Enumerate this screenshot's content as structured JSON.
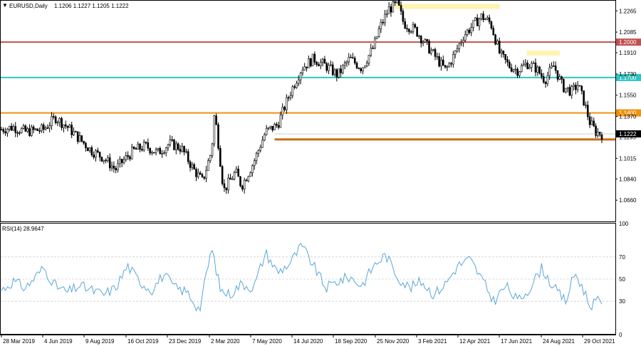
{
  "header": {
    "symbol": "EURUSD,Daily",
    "ohlc": "1.1206 1.1227 1.1205 1.1222",
    "rsi_label": "RSI(14) 28.9647"
  },
  "chart_data": [
    {
      "type": "candlestick",
      "title": "EURUSD,Daily",
      "ylim": [
        1.048,
        1.2345
      ],
      "y_ticks": [
        "1.2265",
        "1.2085",
        "1.1910",
        "1.1730",
        "1.1550",
        "1.1370",
        "1.1195",
        "1.1015",
        "1.0840",
        "1.0660"
      ],
      "x_ticks": [
        "28 Mar 2019",
        "4 Jun 2019",
        "9 Aug 2019",
        "16 Oct 2019",
        "23 Dec 2019",
        "2 Mar 2020",
        "7 May 2020",
        "14 Jul 2020",
        "18 Sep 2020",
        "25 Nov 2020",
        "3 Feb 2021",
        "12 Apr 2021",
        "17 Jun 2021",
        "24 Aug 2021",
        "29 Oct 2021"
      ],
      "price_path": [
        [
          0,
          1.126
        ],
        [
          0.02,
          1.128
        ],
        [
          0.04,
          1.124
        ],
        [
          0.07,
          1.126
        ],
        [
          0.09,
          1.136
        ],
        [
          0.11,
          1.128
        ],
        [
          0.13,
          1.118
        ],
        [
          0.15,
          1.108
        ],
        [
          0.17,
          1.102
        ],
        [
          0.19,
          1.092
        ],
        [
          0.2,
          1.098
        ],
        [
          0.22,
          1.108
        ],
        [
          0.24,
          1.112
        ],
        [
          0.26,
          1.106
        ],
        [
          0.28,
          1.114
        ],
        [
          0.3,
          1.11
        ],
        [
          0.32,
          1.092
        ],
        [
          0.335,
          1.082
        ],
        [
          0.35,
          1.108
        ],
        [
          0.355,
          1.14
        ],
        [
          0.36,
          1.12
        ],
        [
          0.37,
          1.074
        ],
        [
          0.39,
          1.09
        ],
        [
          0.4,
          1.078
        ],
        [
          0.42,
          1.098
        ],
        [
          0.44,
          1.124
        ],
        [
          0.46,
          1.13
        ],
        [
          0.48,
          1.156
        ],
        [
          0.5,
          1.178
        ],
        [
          0.52,
          1.186
        ],
        [
          0.54,
          1.18
        ],
        [
          0.56,
          1.172
        ],
        [
          0.58,
          1.186
        ],
        [
          0.6,
          1.178
        ],
        [
          0.62,
          1.196
        ],
        [
          0.63,
          1.212
        ],
        [
          0.645,
          1.228
        ],
        [
          0.66,
          1.232
        ],
        [
          0.67,
          1.216
        ],
        [
          0.69,
          1.21
        ],
        [
          0.71,
          1.196
        ],
        [
          0.725,
          1.186
        ],
        [
          0.74,
          1.176
        ],
        [
          0.755,
          1.19
        ],
        [
          0.77,
          1.206
        ],
        [
          0.785,
          1.214
        ],
        [
          0.8,
          1.222
        ],
        [
          0.815,
          1.216
        ],
        [
          0.83,
          1.19
        ],
        [
          0.845,
          1.18
        ],
        [
          0.86,
          1.176
        ],
        [
          0.875,
          1.182
        ],
        [
          0.89,
          1.178
        ],
        [
          0.905,
          1.168
        ],
        [
          0.92,
          1.18
        ],
        [
          0.935,
          1.162
        ],
        [
          0.95,
          1.158
        ],
        [
          0.96,
          1.164
        ],
        [
          0.97,
          1.15
        ],
        [
          0.98,
          1.132
        ],
        [
          0.99,
          1.124
        ],
        [
          1.0,
          1.122
        ]
      ],
      "last_price": "1.1222",
      "levels": [
        {
          "value": 1.2,
          "label": "1.2000",
          "color": "#c25050"
        },
        {
          "value": 1.17,
          "label": "1.1700",
          "color": "#2ec4c4"
        },
        {
          "value": 1.14,
          "label": "1.1400",
          "color": "#f0920e"
        },
        {
          "value": 1.1175,
          "label": "",
          "color": "#cc6a10"
        }
      ],
      "level_labels_start_date": "",
      "highlights": [
        {
          "from": 0.655,
          "to": 0.83,
          "value": 1.2305,
          "color": "#fff3b0"
        },
        {
          "from": 0.875,
          "to": 0.93,
          "value": 1.191,
          "color": "#fff3b0"
        }
      ],
      "support_line": {
        "from": 0.455,
        "to": 1.0,
        "value": 1.1175,
        "color": "#cc6a10"
      }
    },
    {
      "type": "line",
      "title": "RSI(14) 28.9647",
      "ylim": [
        0,
        100
      ],
      "y_ticks": [
        "100",
        "70",
        "50",
        "30",
        "0"
      ],
      "reference_levels": [
        70,
        50,
        30
      ],
      "line_color": "#5aa6d8",
      "value_path": [
        [
          0,
          40
        ],
        [
          0.02,
          48
        ],
        [
          0.04,
          42
        ],
        [
          0.07,
          60
        ],
        [
          0.09,
          44
        ],
        [
          0.11,
          38
        ],
        [
          0.13,
          44
        ],
        [
          0.15,
          40
        ],
        [
          0.17,
          36
        ],
        [
          0.19,
          42
        ],
        [
          0.21,
          62
        ],
        [
          0.23,
          48
        ],
        [
          0.25,
          40
        ],
        [
          0.27,
          54
        ],
        [
          0.29,
          42
        ],
        [
          0.31,
          38
        ],
        [
          0.33,
          22
        ],
        [
          0.35,
          78
        ],
        [
          0.365,
          40
        ],
        [
          0.38,
          36
        ],
        [
          0.4,
          46
        ],
        [
          0.42,
          42
        ],
        [
          0.44,
          74
        ],
        [
          0.46,
          56
        ],
        [
          0.48,
          64
        ],
        [
          0.5,
          80
        ],
        [
          0.52,
          62
        ],
        [
          0.54,
          42
        ],
        [
          0.56,
          48
        ],
        [
          0.58,
          52
        ],
        [
          0.6,
          44
        ],
        [
          0.62,
          62
        ],
        [
          0.64,
          72
        ],
        [
          0.66,
          52
        ],
        [
          0.68,
          42
        ],
        [
          0.7,
          48
        ],
        [
          0.72,
          36
        ],
        [
          0.74,
          46
        ],
        [
          0.76,
          62
        ],
        [
          0.78,
          68
        ],
        [
          0.8,
          50
        ],
        [
          0.82,
          30
        ],
        [
          0.84,
          44
        ],
        [
          0.86,
          30
        ],
        [
          0.88,
          42
        ],
        [
          0.9,
          60
        ],
        [
          0.92,
          42
        ],
        [
          0.94,
          30
        ],
        [
          0.955,
          56
        ],
        [
          0.97,
          40
        ],
        [
          0.98,
          26
        ],
        [
          0.99,
          30
        ],
        [
          1.0,
          29
        ]
      ],
      "current_value": "28.9647"
    }
  ],
  "colors": {
    "background": "#ffffff",
    "frame": "#000000",
    "candle": "#000000",
    "grid": "#cfcfcf",
    "last_price_bg": "#000000",
    "last_price_text": "#ffffff"
  }
}
